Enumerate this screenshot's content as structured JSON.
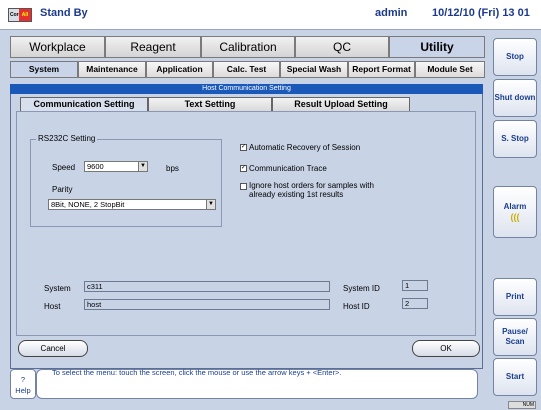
{
  "header": {
    "mode_badge_left": "Core",
    "mode_badge_right": "All",
    "status": "Stand By",
    "user": "admin",
    "datetime": "10/12/10 (Fri) 13 01"
  },
  "main_tabs": [
    {
      "label": "Workplace",
      "active": false
    },
    {
      "label": "Reagent",
      "active": false
    },
    {
      "label": "Calibration",
      "active": false
    },
    {
      "label": "QC",
      "active": false
    },
    {
      "label": "Utility",
      "active": true
    }
  ],
  "sub_tabs": [
    {
      "label": "System",
      "active": true
    },
    {
      "label": "Maintenance",
      "active": false
    },
    {
      "label": "Application",
      "active": false
    },
    {
      "label": "Calc. Test",
      "active": false
    },
    {
      "label": "Special Wash",
      "active": false
    },
    {
      "label": "Report Format",
      "active": false
    },
    {
      "label": "Module Set",
      "active": false
    }
  ],
  "panel": {
    "title": "Host Communication Setting",
    "tabs": [
      {
        "label": "Communication Setting",
        "active": true
      },
      {
        "label": "Text Setting",
        "active": false
      },
      {
        "label": "Result Upload Setting",
        "active": false
      }
    ],
    "rs232c": {
      "group_label": "RS232C Setting",
      "speed_label": "Speed",
      "speed_value": "9600",
      "speed_unit": "bps",
      "parity_label": "Parity",
      "parity_value": "8Bit, NONE, 2 StopBit"
    },
    "options": [
      {
        "label": "Automatic Recovery of Session",
        "checked": true
      },
      {
        "label": "Communication Trace",
        "checked": true
      },
      {
        "label": "Ignore host orders for samples with already existing 1st results",
        "checked": false
      }
    ],
    "system_label": "System",
    "system_value": "c311",
    "host_label": "Host",
    "host_value": "host",
    "system_id_label": "System ID",
    "system_id_value": "1",
    "host_id_label": "Host ID",
    "host_id_value": "2",
    "cancel_label": "Cancel",
    "ok_label": "OK"
  },
  "side_buttons": [
    "Stop",
    "Shut down",
    "S. Stop",
    "Alarm",
    "Print",
    "Pause/ Scan",
    "Start"
  ],
  "help": {
    "button_label_1": "?",
    "button_label_2": "Help",
    "text": "To select the menu: touch the screen, click the mouse or use the arrow keys + <Enter>."
  },
  "statusbar": {
    "num": "NUM"
  },
  "colors": {
    "accent": "#1a59b8",
    "text_blue": "#1c3a8c",
    "background": "#c8d3e6"
  }
}
